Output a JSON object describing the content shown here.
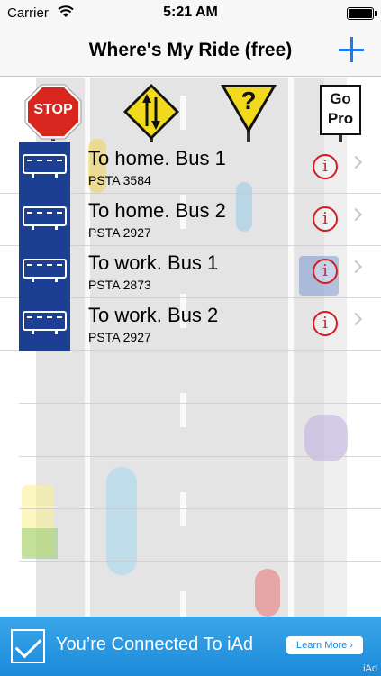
{
  "status_bar": {
    "carrier": "Carrier",
    "time": "5:21 AM"
  },
  "nav": {
    "title": "Where's My Ride (free)",
    "add_icon": "plus-icon"
  },
  "toolbar": {
    "stop_label": "STOP",
    "two_way_icon": "two-way-arrows-sign-icon",
    "help_label": "?",
    "go_pro_line1": "Go",
    "go_pro_line2": "Pro"
  },
  "routes": [
    {
      "name": "To home. Bus 1",
      "stop": "PSTA 3584"
    },
    {
      "name": "To home. Bus 2",
      "stop": "PSTA 2927"
    },
    {
      "name": "To work. Bus 1",
      "stop": "PSTA 2873"
    },
    {
      "name": "To work. Bus 2",
      "stop": "PSTA 2927"
    }
  ],
  "info_glyph": "i",
  "ad": {
    "text": "You’re Connected To iAd",
    "button": "Learn More ›",
    "label": "iAd"
  },
  "colors": {
    "accent": "#1a7bf5",
    "info_red": "#d21f1f",
    "bus_blue": "#1c3f94",
    "ad_blue": "#1b8ad8"
  }
}
